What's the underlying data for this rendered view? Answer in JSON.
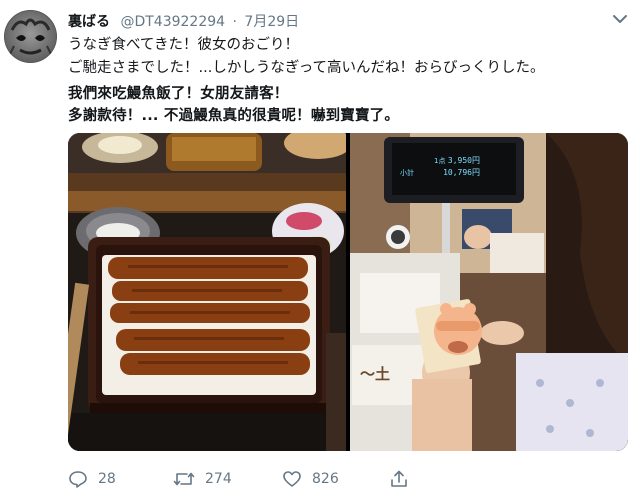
{
  "tweet": {
    "author_name": "裏ばる",
    "handle": "@DT43922294",
    "separator": "·",
    "date": "7月29日",
    "lines": [
      "うなぎ食べてきた！彼女のおごり！",
      "ご馳走さまでした！...しかしうなぎって高いんだね！おらびっくりした。",
      "我們來吃鰻魚飯了！女朋友請客！",
      "多謝款待！... 不過鰻魚真的很貴呢！嚇到寶寶了。"
    ]
  },
  "media": {
    "register_display": {
      "line1": "3,950円",
      "line2": "10,796円",
      "tag": "小計",
      "small": "1点"
    },
    "sign_text": "～土"
  },
  "actions": {
    "replies": "28",
    "retweets": "274",
    "likes": "826"
  },
  "icons": [
    "avatar",
    "chevron-down-icon",
    "reply-icon",
    "retweet-icon",
    "like-icon",
    "share-icon"
  ]
}
